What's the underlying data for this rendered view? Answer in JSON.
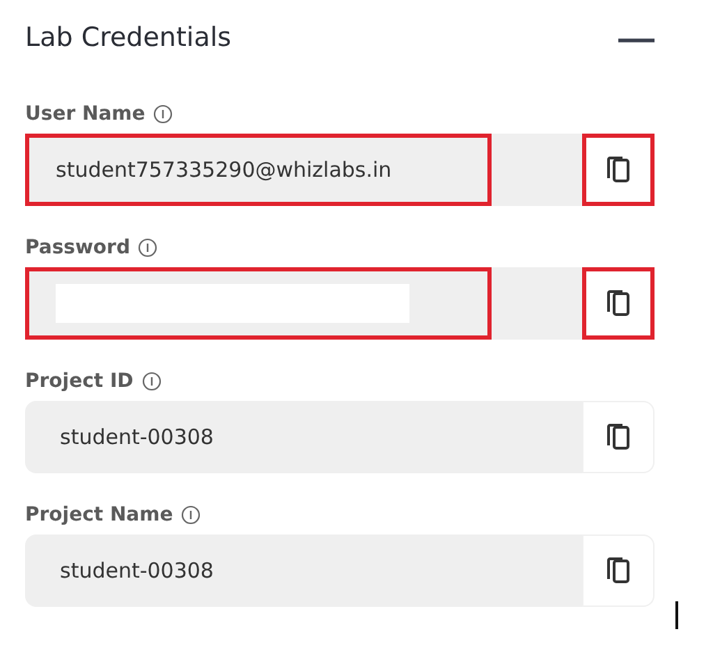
{
  "panel": {
    "title": "Lab Credentials",
    "collapse_symbol": "—"
  },
  "fields": [
    {
      "label": "User Name",
      "value": "student757335290@whizlabs.in",
      "highlighted": true,
      "redacted": false
    },
    {
      "label": "Password",
      "highlighted": true,
      "redacted": true
    },
    {
      "label": "Project ID",
      "value": "student-00308",
      "highlighted": false,
      "redacted": false
    },
    {
      "label": "Project Name",
      "value": "student-00308",
      "highlighted": false,
      "redacted": false
    }
  ]
}
